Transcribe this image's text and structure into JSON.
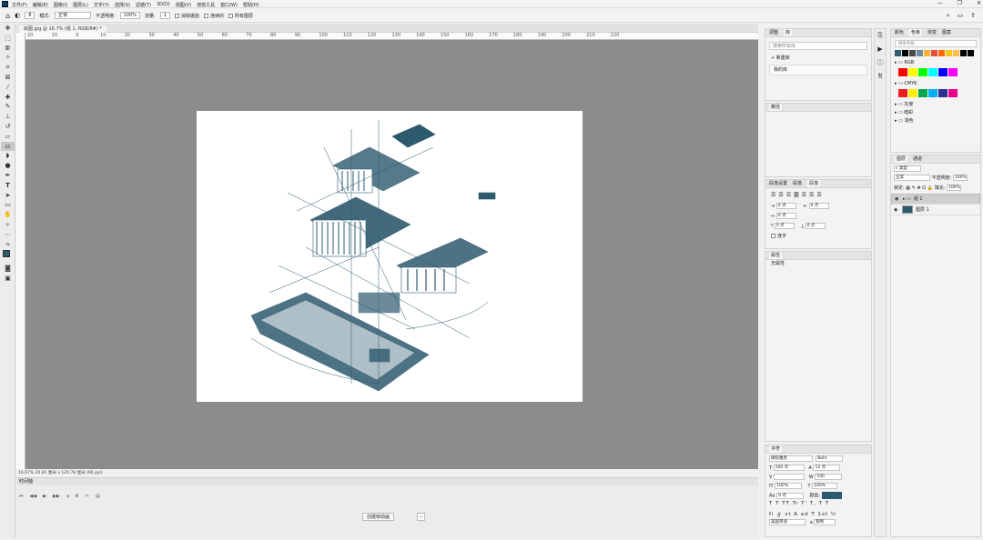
{
  "menubar": {
    "items": [
      "文件(F)",
      "编辑(E)",
      "图像(I)",
      "图层(L)",
      "文字(Y)",
      "选择(S)",
      "滤镜(T)",
      "3D(D)",
      "视图(V)",
      "增效工具",
      "窗口(W)",
      "帮助(H)"
    ],
    "window_controls": [
      "—",
      "❐",
      "✕"
    ]
  },
  "options": {
    "size_value": "8",
    "mode_label": "模式:",
    "mode_value": "正常",
    "opacity_label": "不透明度:",
    "opacity_value": "100%",
    "flow_label": "流量:",
    "flow_value": "1",
    "smooth_label": "消除锯齿",
    "contiguous_label": "连续的",
    "all_layers_label": "所有图层"
  },
  "document": {
    "tab_title": "绘图.jpg @ 16.7% (组 1, RGB/8#) *",
    "status": "16.67%  20.81 厘米 x 120.78 厘米 (96 ppi)"
  },
  "ruler_ticks": [
    "20",
    "10",
    "0",
    "10",
    "20",
    "30",
    "40",
    "50",
    "60",
    "70",
    "80",
    "90",
    "100",
    "110",
    "120",
    "130",
    "140",
    "150",
    "160",
    "170",
    "180",
    "190",
    "200",
    "210",
    "220"
  ],
  "timeline": {
    "title": "时间轴",
    "create_button": "创建帧动画"
  },
  "panels": {
    "library": {
      "tabs": [
        "调整",
        "库"
      ],
      "search_placeholder": "搜索所有库",
      "new_library": "新建库",
      "my_library": "我的库"
    },
    "adjust": {
      "tabs": [
        "路径"
      ]
    },
    "paragraph": {
      "tabs": [
        "段落设置",
        "段落",
        "段落"
      ],
      "fields": [
        "0 点",
        "0 点",
        "0 点",
        "0 点",
        "0 点"
      ],
      "hyphen_label": "连字"
    },
    "properties": {
      "tabs": [
        "属性"
      ],
      "empty_label": "无属性"
    },
    "character": {
      "tabs": [
        "字符"
      ],
      "font": "微软雅黑",
      "style": "Bold",
      "size": "100 点",
      "leading": "13 点",
      "tracking": "100",
      "scale_v": "100%",
      "scale_h": "100%",
      "baseline": "0 点",
      "color_label": "颜色:",
      "lang": "美国英语",
      "aa": "锐利"
    }
  },
  "swatches": {
    "tabs": [
      "颜色",
      "色板",
      "渐变",
      "图案"
    ],
    "search_placeholder": "搜索色板",
    "recent": [
      "#2e5a6e",
      "#000000",
      "#4a4a4a",
      "#6b8e9f",
      "#f9b234",
      "#e74c3c",
      "#ff6a00",
      "#f5c518",
      "#ffc04d",
      "#000000",
      "#000000"
    ],
    "groups": [
      {
        "name": "RGB",
        "colors": [
          "#ff0000",
          "#ffff00",
          "#00ff00",
          "#00ffff",
          "#0000ff",
          "#ff00ff"
        ]
      },
      {
        "name": "CMYK",
        "colors": [
          "#ed1c24",
          "#fff200",
          "#00a651",
          "#00aeef",
          "#2e3192",
          "#ec008c"
        ]
      },
      {
        "name": "灰度"
      },
      {
        "name": "暗彩"
      },
      {
        "name": "浅色"
      }
    ]
  },
  "layers": {
    "tabs": [
      "图层",
      "通道"
    ],
    "filter_label": "类型",
    "blend_mode": "正常",
    "opacity_label": "不透明度:",
    "opacity_value": "100%",
    "lock_label": "锁定:",
    "fill_label": "填充:",
    "fill_value": "100%",
    "items": [
      {
        "name": "组 1",
        "selected": true
      },
      {
        "name": "图层 1",
        "selected": false
      }
    ]
  },
  "colors": {
    "accent": "#2e5a6e",
    "canvas_bg": "#8c8c8c"
  }
}
